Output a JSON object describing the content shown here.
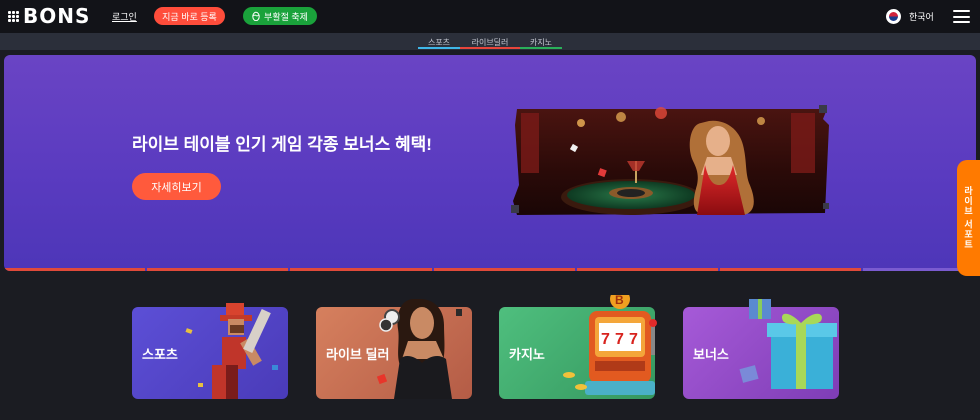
{
  "header": {
    "logo_text": "BONS",
    "login_label": "로그인",
    "register_label": "지금 바로 등록",
    "festival_label": "부활절 축제",
    "festival_icon": "egg-icon",
    "language_label": "한국어",
    "language_flag": "korea-flag-icon",
    "menu_icon": "hamburger-menu-icon"
  },
  "subnav": {
    "tabs": [
      {
        "label": "스포츠",
        "color": "#3fb7e8"
      },
      {
        "label": "라이브딜러",
        "color": "#e8453b"
      },
      {
        "label": "카지노",
        "color": "#2ab05a"
      }
    ]
  },
  "hero": {
    "title": "라이브 테이블 인기 게임 각종 보너스 혜택!",
    "button_label": "자세히보기",
    "slides_total": 7,
    "active_slide": 7,
    "image_subject": "live-casino-dealer-roulette"
  },
  "side_tab": {
    "label": "라이브 서포트"
  },
  "categories": [
    {
      "label": "스포츠",
      "color": "#5a49c8"
    },
    {
      "label": "라이브 딜러",
      "color": "#c76d52"
    },
    {
      "label": "카지노",
      "color": "#3fa673"
    },
    {
      "label": "보너스",
      "color": "#8b4fc6"
    }
  ]
}
